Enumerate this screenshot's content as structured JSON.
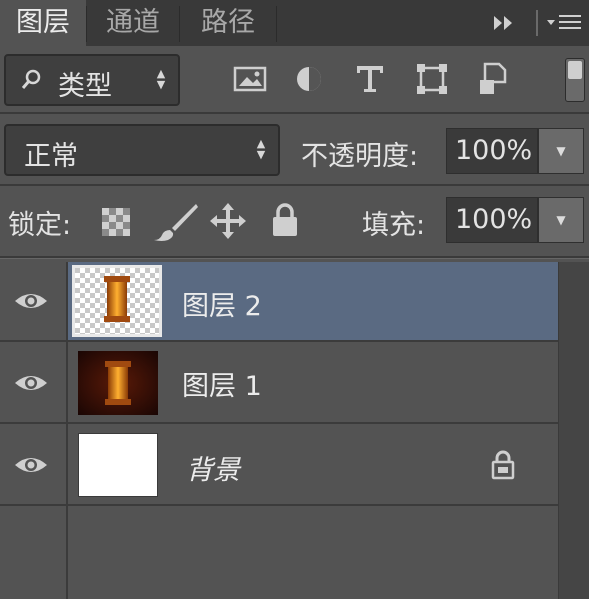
{
  "tabs": [
    {
      "label": "图层",
      "active": true
    },
    {
      "label": "通道",
      "active": false
    },
    {
      "label": "路径",
      "active": false
    }
  ],
  "panel_menu_icons": [
    "double-arrow-icon",
    "panel-menu-icon"
  ],
  "filter": {
    "kind_label": "类型",
    "filter_icons": [
      "image-filter-icon",
      "adjustment-filter-icon",
      "text-filter-icon",
      "shape-filter-icon",
      "smart-object-filter-icon"
    ]
  },
  "blend": {
    "mode_label": "正常",
    "opacity_label": "不透明度:",
    "opacity_value": "100%"
  },
  "lock": {
    "label": "锁定:",
    "fill_label": "填充:",
    "fill_value": "100%",
    "icons": [
      "lock-transparency-icon",
      "lock-image-pixels-icon",
      "lock-position-icon",
      "lock-all-icon"
    ]
  },
  "layers": [
    {
      "name": "图层 2",
      "selected": true,
      "thumbnail": "transparent-with-lantern",
      "visible": true
    },
    {
      "name": "图层 1",
      "selected": false,
      "thumbnail": "dark-with-lantern",
      "visible": true
    },
    {
      "name": "背景",
      "selected": false,
      "thumbnail": "white",
      "visible": true,
      "locked": true
    }
  ],
  "colors": {
    "panel_bg": "#535353",
    "tabbar_bg": "#393939",
    "selected_layer": "#5a6a82",
    "field_bg": "#3f3f3f"
  }
}
